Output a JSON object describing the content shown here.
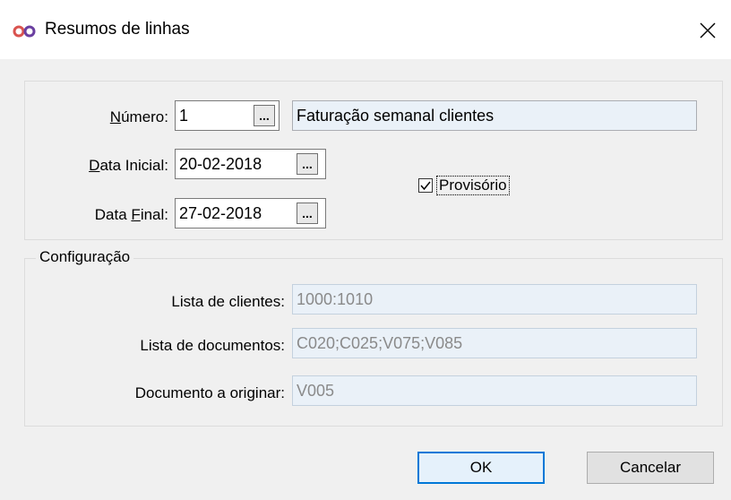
{
  "window": {
    "title": "Resumos de linhas",
    "icon": "infinity-logo-icon",
    "close_icon": "close-icon"
  },
  "header": {
    "numero": {
      "label_accel": "N",
      "label_rest": "úmero:",
      "value": "1",
      "description": "Faturação semanal clientes",
      "lookup_label": "..."
    },
    "data_inicial": {
      "label_accel": "D",
      "label_rest": "ata Inicial:",
      "value": "20-02-2018",
      "lookup_label": "..."
    },
    "data_final": {
      "label_pre": "Data ",
      "label_accel": "F",
      "label_rest": "inal:",
      "value": "27-02-2018",
      "lookup_label": "..."
    },
    "provisorio": {
      "label": "Provisório",
      "checked": true
    }
  },
  "config": {
    "title": "Configuração",
    "lista_clientes": {
      "label": "Lista de clientes:",
      "value": "1000:1010"
    },
    "lista_documentos": {
      "label": "Lista de documentos:",
      "value": "C020;C025;V075;V085"
    },
    "documento_originar": {
      "label": "Documento a originar:",
      "value": "V005"
    }
  },
  "buttons": {
    "ok": "OK",
    "cancel": "Cancelar"
  }
}
